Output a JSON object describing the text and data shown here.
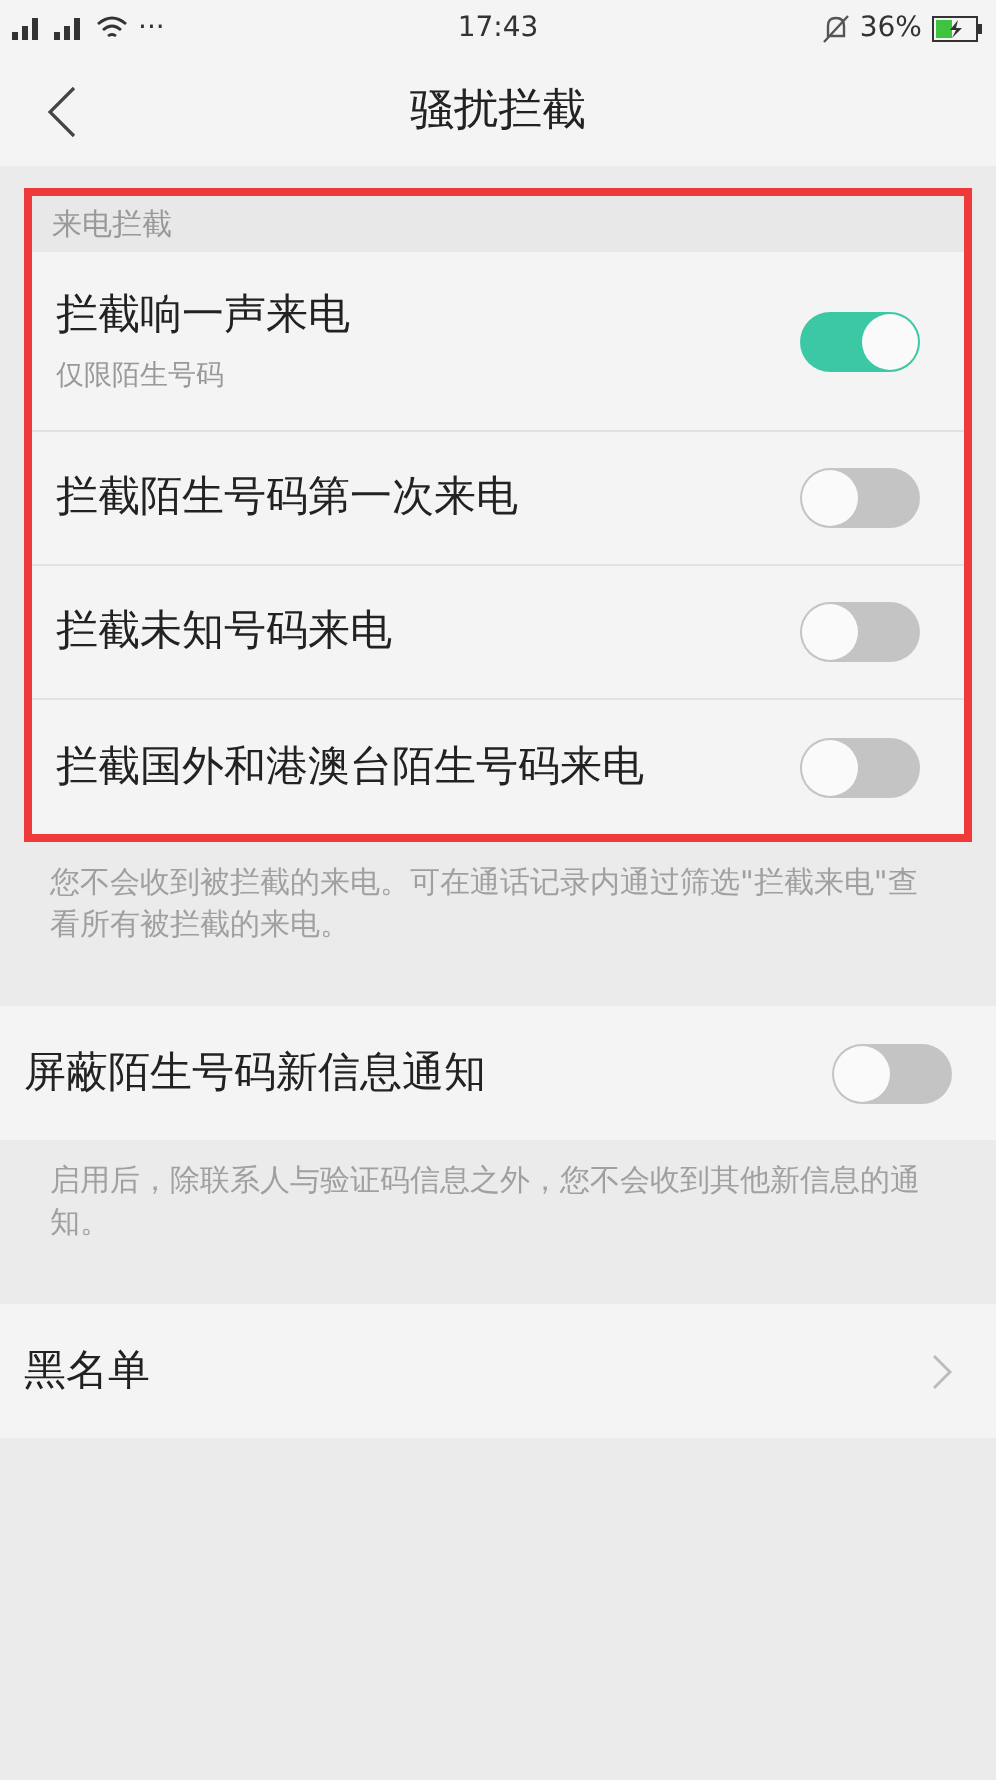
{
  "status_bar": {
    "more": "···",
    "time": "17:43",
    "battery": "36%"
  },
  "nav": {
    "title": "骚扰拦截"
  },
  "sections": [
    {
      "header": "来电拦截",
      "highlighted": true,
      "rows": [
        {
          "kind": "switch",
          "label": "拦截响一声来电",
          "sublabel": "仅限陌生号码",
          "on": true
        },
        {
          "kind": "switch",
          "label": "拦截陌生号码第一次来电",
          "on": false
        },
        {
          "kind": "switch",
          "label": "拦截未知号码来电",
          "on": false
        },
        {
          "kind": "switch",
          "label": "拦截国外和港澳台陌生号码来电",
          "on": false
        }
      ],
      "footer": "您不会收到被拦截的来电。可在通话记录内通过筛选\"拦截来电\"查看所有被拦截的来电。"
    },
    {
      "highlighted": false,
      "rows": [
        {
          "kind": "switch",
          "label": "屏蔽陌生号码新信息通知",
          "on": false
        }
      ],
      "footer": "启用后，除联系人与验证码信息之外，您不会收到其他新信息的通知。"
    },
    {
      "highlighted": false,
      "rows": [
        {
          "kind": "link",
          "label": "黑名单"
        }
      ]
    }
  ]
}
